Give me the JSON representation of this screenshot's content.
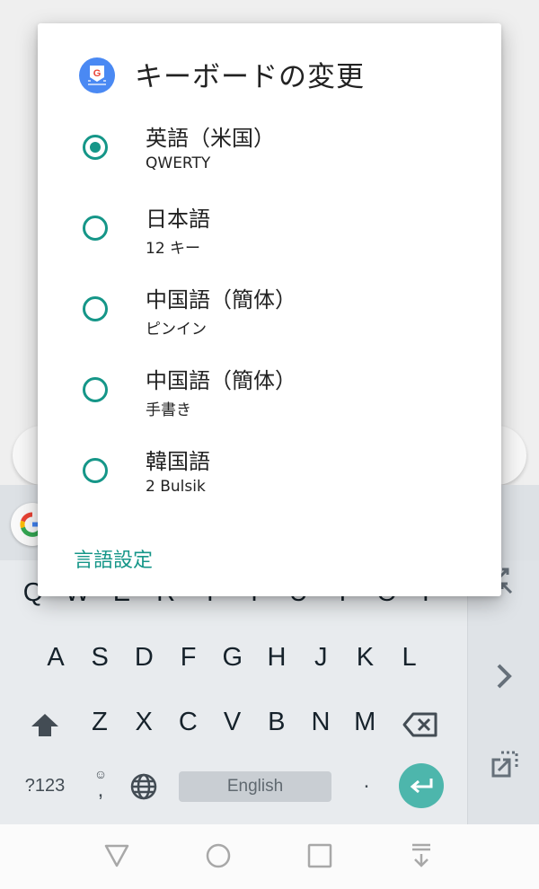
{
  "dialog": {
    "title": "キーボードの変更",
    "options": [
      {
        "label": "英語（米国）",
        "sub": "QWERTY",
        "selected": true
      },
      {
        "label": "日本語",
        "sub": "12 キー",
        "selected": false
      },
      {
        "label": "中国語（簡体）",
        "sub": "ピンイン",
        "selected": false
      },
      {
        "label": "中国語（簡体）",
        "sub": "手書き",
        "selected": false
      },
      {
        "label": "韓国語",
        "sub": "2 Bulsik",
        "selected": false
      }
    ],
    "settings_link": "言語設定",
    "accent_color": "#159688"
  },
  "keyboard": {
    "row1": [
      "Q",
      "W",
      "E",
      "R",
      "T",
      "Y",
      "U",
      "I",
      "O",
      "P"
    ],
    "row2": [
      "A",
      "S",
      "D",
      "F",
      "G",
      "H",
      "J",
      "K",
      "L"
    ],
    "row3": [
      "Z",
      "X",
      "C",
      "V",
      "B",
      "N",
      "M"
    ],
    "symbols_key": "?123",
    "comma_key": ",",
    "period_key": ".",
    "space_label": "English",
    "enter_color": "#4db6ac"
  },
  "side_panel": {
    "icons": [
      "resize-icon",
      "chevron-right-icon",
      "float-keyboard-icon"
    ]
  },
  "navbar": {
    "icons": [
      "back-icon",
      "home-icon",
      "recents-icon",
      "hide-keyboard-icon"
    ]
  }
}
